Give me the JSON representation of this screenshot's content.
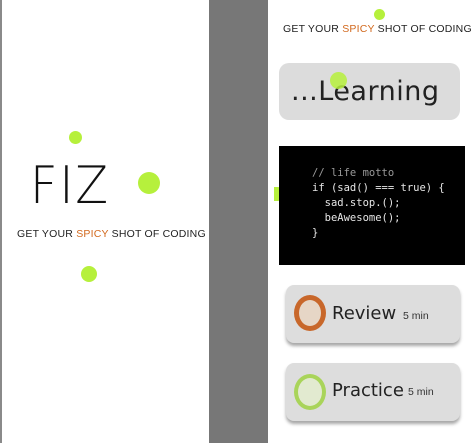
{
  "splash": {
    "logo_text": "FIZ",
    "tagline_before": "GET YOUR ",
    "tagline_spicy": "SPICY",
    "tagline_after": " SHOT OF CODING"
  },
  "menu": {
    "tagline_before": "GET YOUR ",
    "tagline_spicy": "SPICY",
    "tagline_after": " SHOT OF CODING",
    "learning_button_label": "...Learning",
    "code_lines": [
      "// life motto",
      "if (sad() === true) {",
      "  sad.stop.();",
      "  beAwesome();",
      "}"
    ],
    "review": {
      "label": "Review",
      "duration": "5 min",
      "icon": "orange-ring-icon"
    },
    "practice": {
      "label": "Practice",
      "duration": "5 min",
      "icon": "green-ring-icon"
    }
  },
  "colors": {
    "accent_green": "#b6f03c",
    "spicy_orange": "#d2691e",
    "ring_orange": "#c8672a",
    "ring_green": "#a9d45a",
    "divider_gray": "#777777"
  }
}
